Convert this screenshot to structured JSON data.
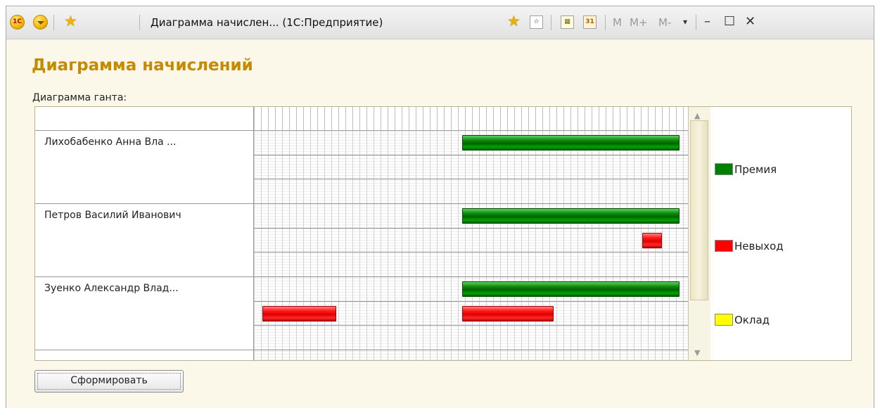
{
  "window": {
    "title": "Диаграмма начислен... (1С:Предприятие)",
    "logo_text": "1С",
    "memory_buttons": [
      "M",
      "M+",
      "M-"
    ]
  },
  "form": {
    "heading": "Диаграмма начислений",
    "gantt_label": "Диаграмма ганта:",
    "submit_label": "Сформировать"
  },
  "colors": {
    "premia": "#008000",
    "nevyhod": "#ff0000",
    "oklad": "#ffff00",
    "heading": "#c58a00"
  },
  "gantt": {
    "employees": [
      {
        "name": "Лихобабенко  Анна Вла ...",
        "rows": [
          [
            {
              "series": "Премия",
              "from": 0.48,
              "to": 0.98
            }
          ],
          [],
          []
        ]
      },
      {
        "name": "Петров Василий Иванович",
        "rows": [
          [
            {
              "series": "Премия",
              "from": 0.48,
              "to": 0.98
            }
          ],
          [
            {
              "series": "Невыход",
              "from": 0.895,
              "to": 0.94
            }
          ],
          []
        ]
      },
      {
        "name": "Зуенко  Александр Влад...",
        "rows": [
          [
            {
              "series": "Премия",
              "from": 0.48,
              "to": 0.98
            }
          ],
          [
            {
              "series": "Невыход",
              "from": 0.02,
              "to": 0.19
            },
            {
              "series": "Невыход",
              "from": 0.48,
              "to": 0.69
            }
          ],
          []
        ]
      }
    ],
    "legend": [
      {
        "label": "Премия",
        "color": "#008000"
      },
      {
        "label": "Невыход",
        "color": "#ff0000"
      },
      {
        "label": "Оклад",
        "color": "#ffff00"
      }
    ]
  }
}
